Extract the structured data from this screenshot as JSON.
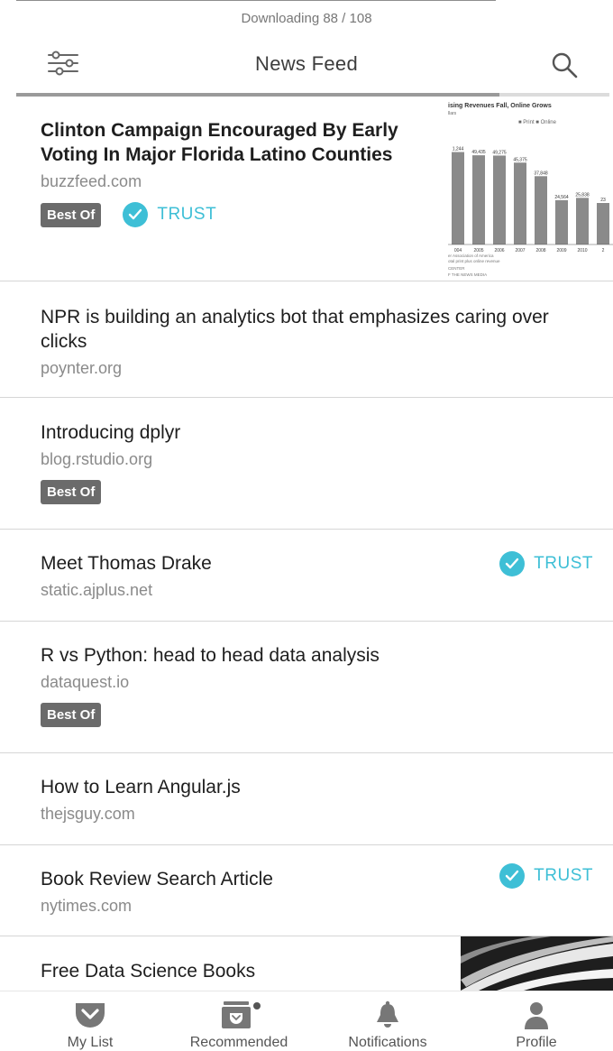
{
  "download": {
    "status": "Downloading 88 / 108",
    "current": 88,
    "total": 108
  },
  "header": {
    "title": "News Feed",
    "filter_icon": "sliders-icon",
    "search_icon": "search-icon"
  },
  "feed": {
    "items": [
      {
        "headline": "Clinton Campaign Encouraged By Early Voting In Major Florida Latino Counties",
        "source": "buzzfeed.com",
        "badge": "Best Of",
        "trust": "TRUST",
        "thumbnail": {
          "title": "ising Revenues Fall, Online Grows",
          "subtitle": "llars",
          "legend": "■ Print  ■ Online",
          "values": [
            {
              "label": "1,244",
              "year": "004"
            },
            {
              "label": "49,435",
              "year": "2005"
            },
            {
              "label": "49,275",
              "year": "2006"
            },
            {
              "label": "45,375",
              "year": "2007"
            },
            {
              "label": "37,848",
              "year": "2008"
            },
            {
              "label": "24,564",
              "year": "2009"
            },
            {
              "label": "25,838",
              "year": "2010"
            },
            {
              "label": "23",
              "year": "2"
            }
          ],
          "bar_values": [
            51244,
            49435,
            49275,
            45375,
            37848,
            24564,
            25838,
            23000
          ],
          "note1": "er Association of America",
          "note2": "otal print plus online revenue",
          "note3": "CENTER",
          "note4": "F THE NEWS MEDIA"
        }
      },
      {
        "headline": "NPR is building an analytics bot that emphasizes caring over clicks",
        "source": "poynter.org"
      },
      {
        "headline": "Introducing dplyr",
        "source": "blog.rstudio.org",
        "badge": "Best Of"
      },
      {
        "headline": "Meet Thomas Drake",
        "source": "static.ajplus.net",
        "trust": "TRUST"
      },
      {
        "headline": "R vs Python: head to head data analysis",
        "source": "dataquest.io",
        "badge": "Best Of"
      },
      {
        "headline": "How to Learn Angular.js",
        "source": "thejsguy.com"
      },
      {
        "headline": "Book Review Search Article",
        "source": "nytimes.com",
        "trust": "TRUST"
      },
      {
        "headline": "Free Data Science Books"
      }
    ]
  },
  "nav": {
    "items": [
      {
        "label": "My List",
        "icon": "pocket-icon"
      },
      {
        "label": "Recommended",
        "icon": "recommended-icon"
      },
      {
        "label": "Notifications",
        "icon": "bell-icon"
      },
      {
        "label": "Profile",
        "icon": "profile-icon"
      }
    ]
  },
  "colors": {
    "trust": "#3ebfd6",
    "badge": "#6b6b6b",
    "nav_icon": "#7a7a7a"
  }
}
